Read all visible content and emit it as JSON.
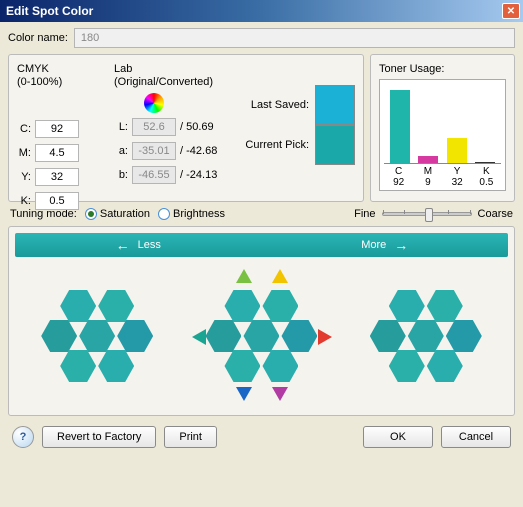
{
  "window": {
    "title": "Edit Spot Color"
  },
  "color_name": {
    "label": "Color name:",
    "value": "180"
  },
  "cmyk": {
    "header1": "CMYK",
    "header2": "(0-100%)",
    "c_label": "C:",
    "c": "92",
    "m_label": "M:",
    "m": "4.5",
    "y_label": "Y:",
    "y": "32",
    "k_label": "K:",
    "k": "0.5"
  },
  "lab": {
    "header1": "Lab",
    "header2": "(Original/Converted)",
    "l_label": "L:",
    "l_orig": "52.6",
    "l_conv": "50.69",
    "a_label": "a:",
    "a_orig": "-35.01",
    "a_conv": "-42.68",
    "b_label": "b:",
    "b_orig": "-46.55",
    "b_conv": "-24.13",
    "sep": "/"
  },
  "swatch": {
    "last_label": "Last Saved:",
    "curr_label": "Current Pick:",
    "last_color": "#1bb0d6",
    "curr_color": "#1ba8a8"
  },
  "toner": {
    "title": "Toner Usage:",
    "labels": {
      "c": "C",
      "m": "M",
      "y": "Y",
      "k": "K"
    },
    "values": {
      "c": "92",
      "m": "9",
      "y": "32",
      "k": "0.5"
    }
  },
  "tuning": {
    "label": "Tuning mode:",
    "saturation": "Saturation",
    "brightness": "Brightness",
    "fine": "Fine",
    "coarse": "Coarse"
  },
  "lessmore": {
    "less": "Less",
    "more": "More"
  },
  "buttons": {
    "help": "?",
    "revert": "Revert to Factory",
    "print": "Print",
    "ok": "OK",
    "cancel": "Cancel"
  },
  "chart_data": {
    "type": "bar",
    "title": "Toner Usage:",
    "categories": [
      "C",
      "M",
      "Y",
      "K"
    ],
    "values": [
      92,
      9,
      32,
      0.5
    ],
    "colors": [
      "#1fb5aa",
      "#d63aa0",
      "#f2e500",
      "#333333"
    ],
    "ylim": [
      0,
      100
    ],
    "xlabel": "",
    "ylabel": ""
  }
}
